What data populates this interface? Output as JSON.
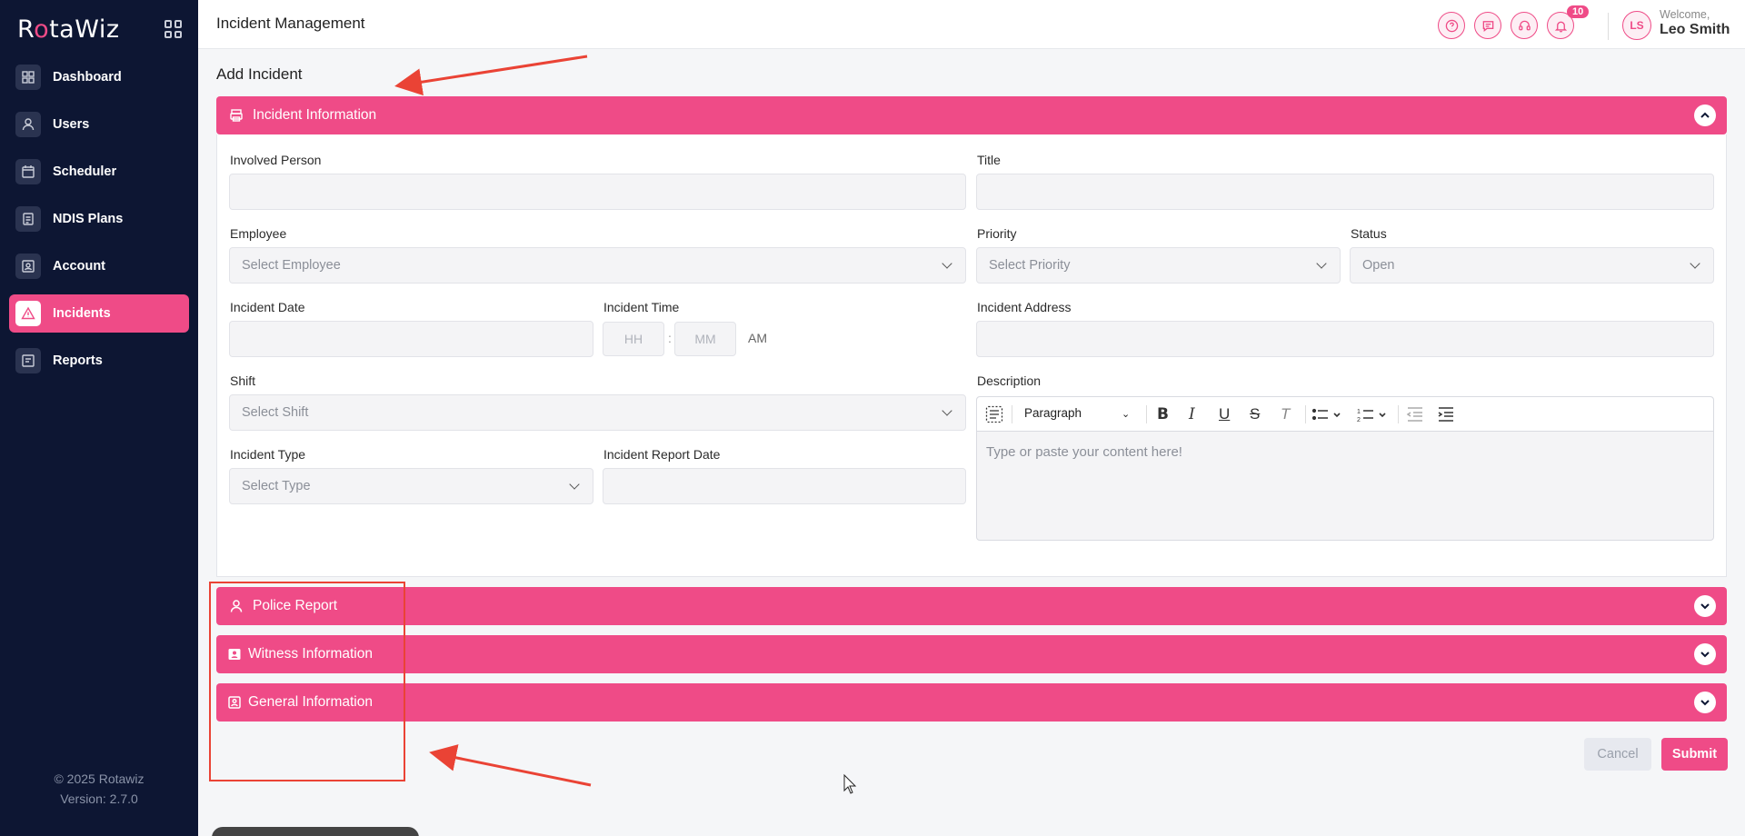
{
  "sidebar": {
    "logo": {
      "pre": "R",
      "o": "o",
      "post": "taWiz"
    },
    "items": [
      {
        "label": "Dashboard",
        "icon": "dashboard-icon"
      },
      {
        "label": "Users",
        "icon": "user-icon"
      },
      {
        "label": "Scheduler",
        "icon": "calendar-icon"
      },
      {
        "label": "NDIS Plans",
        "icon": "document-icon"
      },
      {
        "label": "Account",
        "icon": "id-card-icon"
      },
      {
        "label": "Incidents",
        "icon": "warning-icon",
        "active": true
      },
      {
        "label": "Reports",
        "icon": "report-icon"
      }
    ],
    "copyright": "© 2025 Rotawiz",
    "version": "Version: 2.7.0"
  },
  "header": {
    "title": "Incident Management",
    "notification_count": "10",
    "avatar_initials": "LS",
    "welcome": "Welcome,",
    "user_name": "Leo Smith"
  },
  "page": {
    "heading": "Add Incident"
  },
  "sections": {
    "incident_info": "Incident Information",
    "police_report": "Police Report",
    "witness_info": "Witness Information",
    "general_info": "General Information"
  },
  "form": {
    "involved_person": {
      "label": "Involved Person",
      "value": ""
    },
    "title": {
      "label": "Title",
      "value": ""
    },
    "employee": {
      "label": "Employee",
      "placeholder": "Select Employee"
    },
    "priority": {
      "label": "Priority",
      "placeholder": "Select Priority"
    },
    "status": {
      "label": "Status",
      "value": "Open"
    },
    "incident_date": {
      "label": "Incident Date",
      "value": ""
    },
    "incident_time": {
      "label": "Incident Time",
      "hh": "HH",
      "sep": ":",
      "mm": "MM",
      "ampm": "AM"
    },
    "incident_address": {
      "label": "Incident Address",
      "value": ""
    },
    "shift": {
      "label": "Shift",
      "placeholder": "Select Shift"
    },
    "description": {
      "label": "Description",
      "heading_select": "Paragraph",
      "placeholder": "Type or paste your content here!"
    },
    "incident_type": {
      "label": "Incident Type",
      "placeholder": "Select Type"
    },
    "incident_report_date": {
      "label": "Incident Report Date",
      "value": ""
    }
  },
  "actions": {
    "cancel": "Cancel",
    "submit": "Submit"
  },
  "colors": {
    "brand": "#ef4b87",
    "sidebar": "#0d1633",
    "annotation": "#ea4335"
  }
}
